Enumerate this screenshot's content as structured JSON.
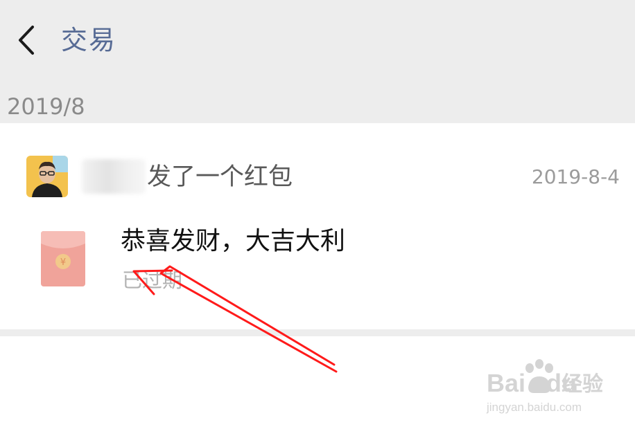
{
  "header": {
    "title": "交易"
  },
  "month": {
    "label": "2019/8"
  },
  "record": {
    "action": "发了一个红包",
    "date": "2019-8-4",
    "greeting": "恭喜发财，大吉大利",
    "status": "已过期"
  },
  "icons": {
    "back": "chevron-left-icon",
    "avatar": "user-avatar",
    "red_envelope": "red-envelope-icon"
  },
  "colors": {
    "header_bg": "#ededed",
    "title": "#576b95",
    "envelope": "#f0a39a",
    "annotation": "#ff0000"
  },
  "watermark": {
    "brand": "Bai",
    "brand_suffix": "du",
    "cn": "经验",
    "url": "jingyan.baidu.com"
  }
}
